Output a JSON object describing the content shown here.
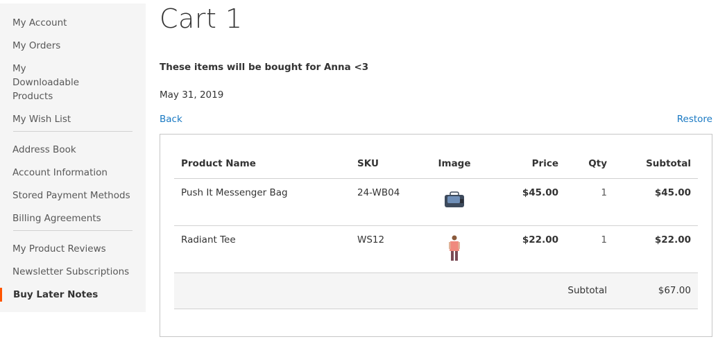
{
  "sidebar": {
    "groups": [
      {
        "items": [
          {
            "label": "My Account"
          },
          {
            "label": "My Orders"
          },
          {
            "label": "My Downloadable Products"
          },
          {
            "label": "My Wish List"
          }
        ]
      },
      {
        "items": [
          {
            "label": "Address Book"
          },
          {
            "label": "Account Information"
          },
          {
            "label": "Stored Payment Methods"
          },
          {
            "label": "Billing Agreements"
          }
        ]
      },
      {
        "items": [
          {
            "label": "My Product Reviews"
          },
          {
            "label": "Newsletter Subscriptions"
          },
          {
            "label": "Buy Later Notes",
            "current": true
          }
        ]
      }
    ],
    "accent_color": "#ff5501"
  },
  "main": {
    "title": "Cart 1",
    "note": "These items will be bought for Anna <3",
    "date": "May 31, 2019",
    "back_label": "Back",
    "restore_label": "Restore",
    "link_color": "#1979c3"
  },
  "table": {
    "headers": {
      "name": "Product Name",
      "sku": "SKU",
      "image": "Image",
      "price": "Price",
      "qty": "Qty",
      "subtotal": "Subtotal"
    },
    "rows": [
      {
        "name": "Push It Messenger Bag",
        "sku": "24-WB04",
        "image_icon": "messenger-bag-thumbnail",
        "price": "$45.00",
        "qty": "1",
        "subtotal": "$45.00"
      },
      {
        "name": "Radiant Tee",
        "sku": "WS12",
        "image_icon": "tee-thumbnail",
        "price": "$22.00",
        "qty": "1",
        "subtotal": "$22.00"
      }
    ],
    "footer": {
      "label": "Subtotal",
      "value": "$67.00"
    }
  }
}
